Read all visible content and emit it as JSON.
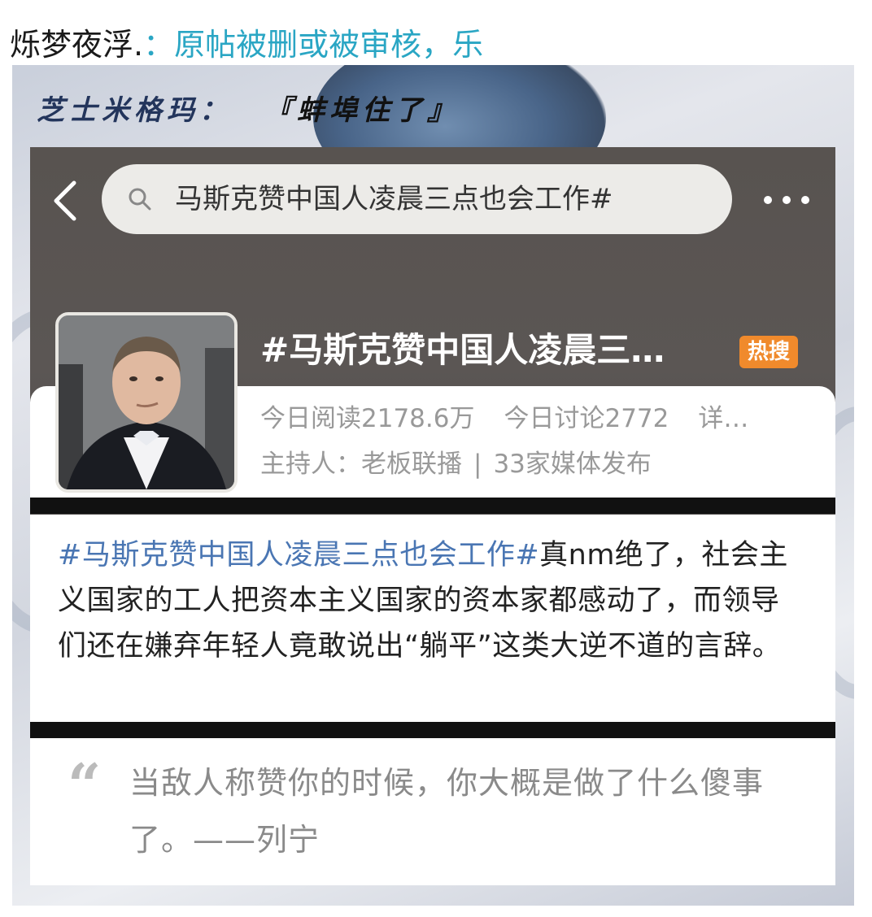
{
  "post": {
    "author": "烁梦夜浮.",
    "separator": "：",
    "text": "原帖被删或被审核，乐"
  },
  "image": {
    "caption": {
      "speaker": "芝士米格玛：",
      "quote": "『蚌埠住了』"
    },
    "screenshot": {
      "search": {
        "query": "马斯克赞中国人凌晨三点也会工作#"
      },
      "topic": {
        "title": "#马斯克赞中国人凌晨三…",
        "badge": "热搜",
        "reads": "今日阅读2178.6万",
        "discussions": "今日讨论2772",
        "details": "详…",
        "host": "主持人：老板联播",
        "divider": "|",
        "media": "33家媒体发布"
      },
      "body": {
        "hashtag": "#马斯克赞中国人凌晨三点也会工作#",
        "text": "真nm绝了，社会主义国家的工人把资本主义国家的资本家都感动了，而领导们还在嫌弃年轻人竟敢说出“躺平”这类大逆不道的言辞。"
      },
      "quote": {
        "mark": "“",
        "text": "当敌人称赞你的时候，你大概是做了什么傻事了。——列宁"
      }
    }
  },
  "icons": {
    "back": "chevron-left-icon",
    "search": "search-icon",
    "more": "more-horizontal-icon"
  },
  "colors": {
    "link": "#2aa6c4",
    "hashtag": "#4a76b3",
    "hot_badge": "#f08a2c",
    "screen_bg": "#585350"
  }
}
